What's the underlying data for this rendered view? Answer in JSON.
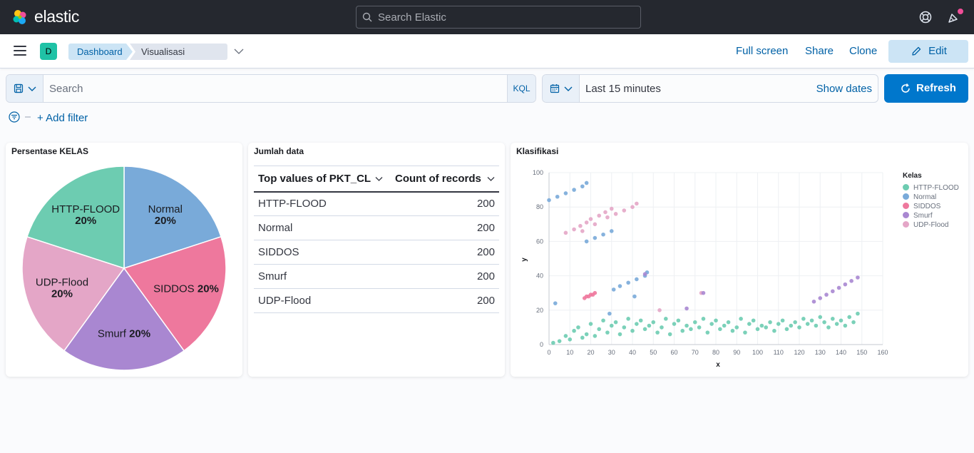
{
  "header": {
    "brand": "elastic",
    "search_placeholder": "Search Elastic"
  },
  "nav": {
    "space_initial": "D",
    "breadcrumbs": [
      "Dashboard",
      "Visualisasi Dataset"
    ],
    "actions": {
      "full_screen": "Full screen",
      "share": "Share",
      "clone": "Clone",
      "edit": "Edit"
    }
  },
  "query": {
    "search_placeholder": "Search",
    "language": "KQL",
    "time_range": "Last 15 minutes",
    "show_dates": "Show dates",
    "refresh": "Refresh",
    "add_filter": "+ Add filter"
  },
  "colors": {
    "HTTP-FLOOD": "#6dccb1",
    "Normal": "#79aad9",
    "SIDDOS": "#ee789d",
    "Smurf": "#a987d1",
    "UDP-Flood": "#e4a6c7"
  },
  "panels": {
    "pie": {
      "title": "Persentase KELAS",
      "slices": [
        {
          "label": "Normal",
          "percent": "20%"
        },
        {
          "label": "SIDDOS",
          "percent": "20%"
        },
        {
          "label": "Smurf",
          "percent": "20%"
        },
        {
          "label": "UDP-Flood",
          "percent": "20%"
        },
        {
          "label": "HTTP-FLOOD",
          "percent": "20%"
        }
      ]
    },
    "table": {
      "title": "Jumlah data",
      "columns": [
        "Top values of PKT_CL",
        "Count of records"
      ],
      "rows": [
        [
          "HTTP-FLOOD",
          "200"
        ],
        [
          "Normal",
          "200"
        ],
        [
          "SIDDOS",
          "200"
        ],
        [
          "Smurf",
          "200"
        ],
        [
          "UDP-Flood",
          "200"
        ]
      ]
    },
    "scatter": {
      "title": "Klasifikasi",
      "legend_title": "Kelas",
      "legend": [
        "HTTP-FLOOD",
        "Normal",
        "SIDDOS",
        "Smurf",
        "UDP-Flood"
      ]
    }
  },
  "chart_data": [
    {
      "type": "pie",
      "title": "Persentase KELAS",
      "categories": [
        "Normal",
        "SIDDOS",
        "Smurf",
        "UDP-Flood",
        "HTTP-FLOOD"
      ],
      "values": [
        20,
        20,
        20,
        20,
        20
      ]
    },
    {
      "type": "scatter",
      "title": "Klasifikasi",
      "xlabel": "x",
      "ylabel": "y",
      "xlim": [
        0,
        160
      ],
      "ylim": [
        0,
        100
      ],
      "xticks": [
        0,
        10,
        20,
        30,
        40,
        50,
        60,
        70,
        80,
        90,
        100,
        110,
        120,
        130,
        140,
        150,
        160
      ],
      "yticks": [
        0,
        20,
        40,
        60,
        80,
        100
      ],
      "grid": true,
      "legend_position": "right",
      "series": [
        {
          "name": "Normal",
          "x": [
            0,
            4,
            8,
            12,
            16,
            18,
            18,
            22,
            26,
            30,
            31,
            34,
            38,
            42,
            46,
            47,
            3,
            29,
            41
          ],
          "y": [
            84,
            86,
            88,
            90,
            92,
            94,
            60,
            62,
            64,
            66,
            32,
            34,
            36,
            38,
            40,
            42,
            24,
            18,
            28
          ]
        },
        {
          "name": "UDP-Flood",
          "x": [
            8,
            12,
            15,
            18,
            20,
            24,
            27,
            30,
            16,
            22,
            28,
            32,
            36,
            40,
            42,
            53,
            73
          ],
          "y": [
            65,
            67,
            69,
            71,
            73,
            75,
            77,
            79,
            66,
            70,
            74,
            76,
            78,
            80,
            82,
            20,
            30
          ]
        },
        {
          "name": "SIDDOS",
          "x": [
            17,
            18,
            19,
            20,
            21,
            22
          ],
          "y": [
            27,
            28,
            28,
            29,
            29,
            30
          ]
        },
        {
          "name": "Smurf",
          "x": [
            127,
            130,
            133,
            136,
            139,
            142,
            145,
            148,
            46,
            66,
            74
          ],
          "y": [
            25,
            27,
            29,
            31,
            33,
            35,
            37,
            39,
            41,
            21,
            30
          ]
        },
        {
          "name": "HTTP-FLOOD",
          "x": [
            2,
            5,
            8,
            10,
            12,
            14,
            16,
            18,
            20,
            22,
            24,
            26,
            28,
            30,
            32,
            34,
            36,
            38,
            40,
            42,
            44,
            46,
            48,
            50,
            52,
            54,
            56,
            58,
            60,
            62,
            64,
            66,
            68,
            70,
            72,
            74,
            76,
            78,
            80,
            82,
            84,
            86,
            88,
            90,
            92,
            94,
            96,
            98,
            100,
            102,
            104,
            106,
            108,
            110,
            112,
            114,
            116,
            118,
            120,
            122,
            124,
            126,
            128,
            130,
            132,
            134,
            136,
            138,
            140,
            142,
            144,
            146,
            148
          ],
          "y": [
            1,
            2,
            5,
            3,
            8,
            10,
            4,
            6,
            12,
            5,
            9,
            14,
            7,
            11,
            13,
            6,
            10,
            15,
            8,
            12,
            14,
            9,
            11,
            13,
            7,
            10,
            15,
            6,
            12,
            14,
            8,
            11,
            9,
            13,
            10,
            15,
            7,
            12,
            14,
            9,
            11,
            13,
            8,
            10,
            15,
            7,
            12,
            14,
            9,
            11,
            10,
            13,
            8,
            12,
            14,
            9,
            11,
            13,
            10,
            15,
            12,
            14,
            11,
            16,
            13,
            10,
            15,
            12,
            14,
            11,
            16,
            13,
            18
          ]
        }
      ]
    }
  ]
}
